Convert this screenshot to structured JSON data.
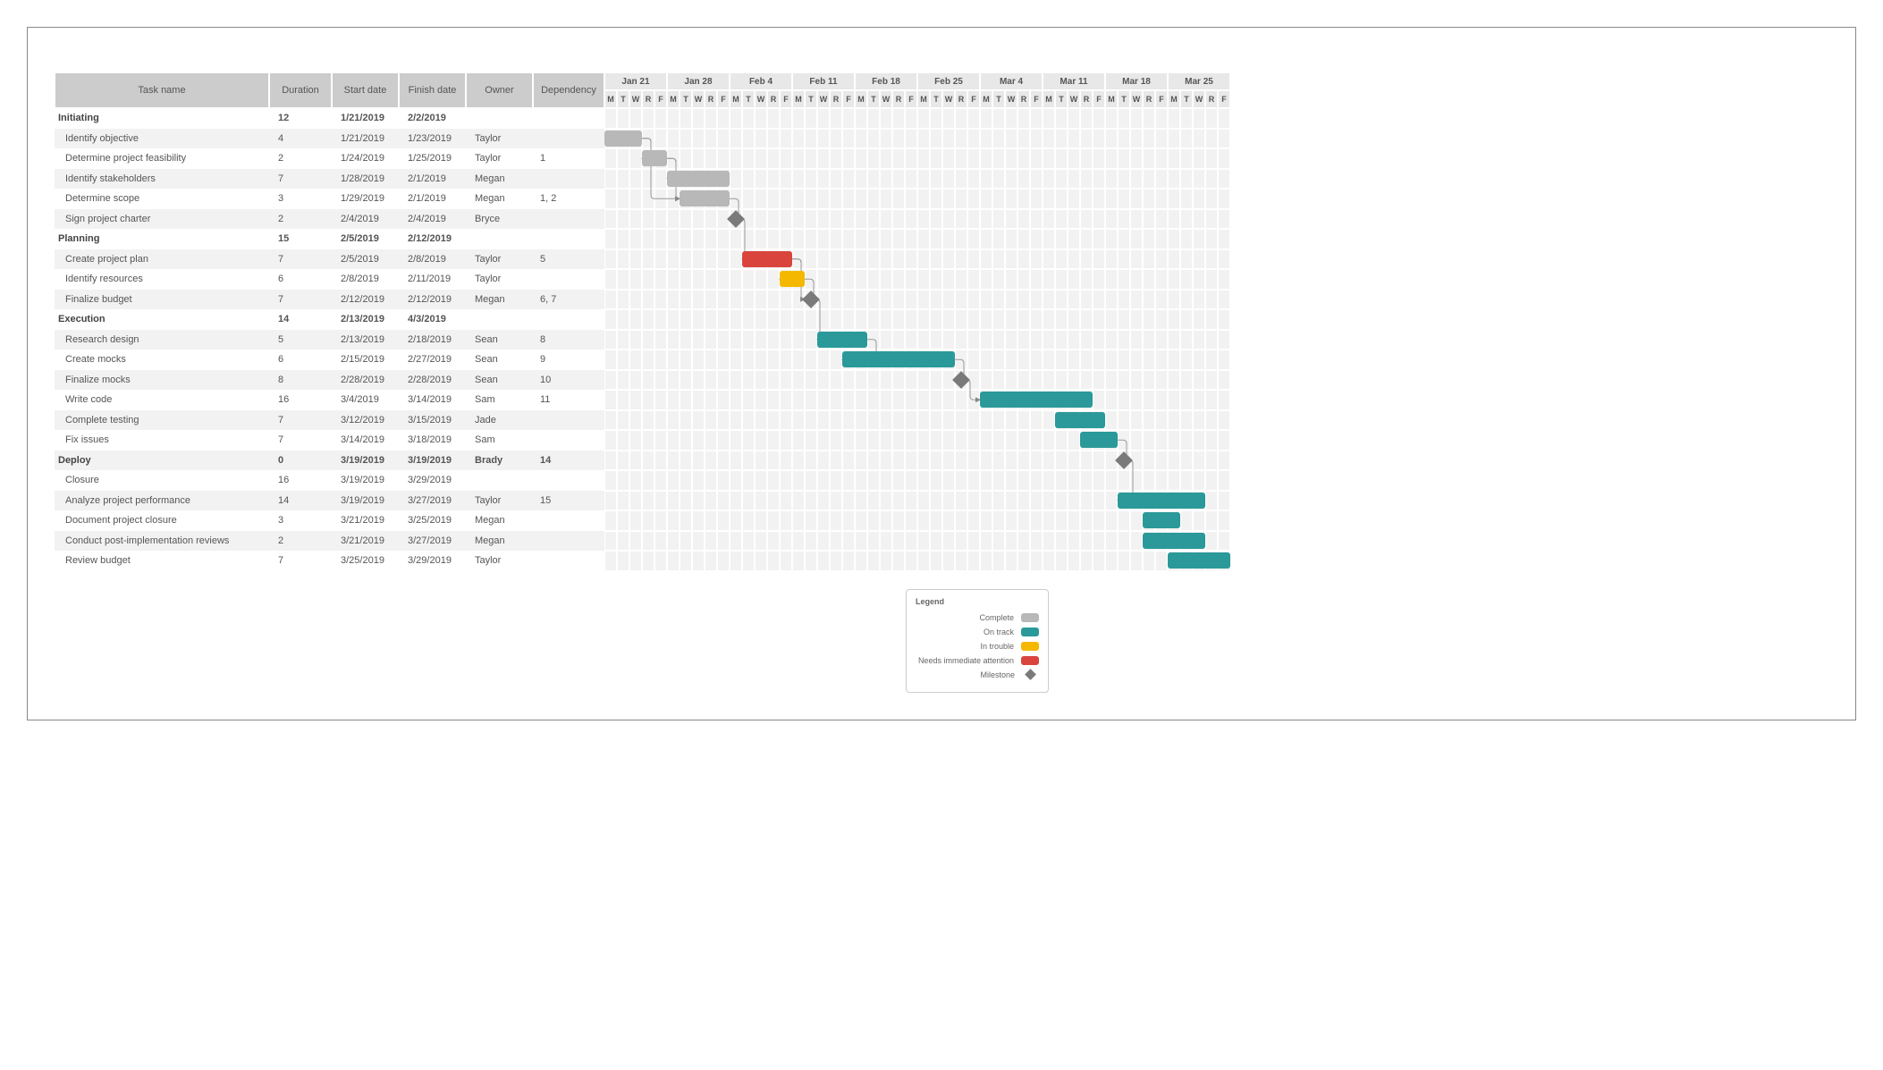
{
  "columns": {
    "task": "Task name",
    "duration": "Duration",
    "start": "Start date",
    "finish": "Finish date",
    "owner": "Owner",
    "dependency": "Dependency"
  },
  "weeks": [
    {
      "label": "Jan 21",
      "start": "2019-01-21"
    },
    {
      "label": "Jan 28",
      "start": "2019-01-28"
    },
    {
      "label": "Feb 4",
      "start": "2019-02-04"
    },
    {
      "label": "Feb 11",
      "start": "2019-02-11"
    },
    {
      "label": "Feb 18",
      "start": "2019-02-18"
    },
    {
      "label": "Feb 25",
      "start": "2019-02-25"
    },
    {
      "label": "Mar 4",
      "start": "2019-03-04"
    },
    {
      "label": "Mar 11",
      "start": "2019-03-11"
    },
    {
      "label": "Mar 18",
      "start": "2019-03-18"
    },
    {
      "label": "Mar 25",
      "start": "2019-03-25"
    }
  ],
  "dayLabels": [
    "M",
    "T",
    "W",
    "R",
    "F"
  ],
  "rows": [
    {
      "type": "group",
      "name": "Initiating",
      "duration": "12",
      "start": "1/21/2019",
      "finish": "2/2/2019",
      "owner": "",
      "dep": ""
    },
    {
      "type": "task",
      "name": "Identify objective",
      "duration": "4",
      "start": "1/21/2019",
      "finish": "1/23/2019",
      "owner": "Taylor",
      "dep": "",
      "barStart": "2019-01-21",
      "barEnd": "2019-01-23",
      "status": "complete"
    },
    {
      "type": "task",
      "name": "Determine project feasibility",
      "duration": "2",
      "start": "1/24/2019",
      "finish": "1/25/2019",
      "owner": "Taylor",
      "dep": "1",
      "barStart": "2019-01-24",
      "barEnd": "2019-01-25",
      "status": "complete"
    },
    {
      "type": "task",
      "name": "Identify stakeholders",
      "duration": "7",
      "start": "1/28/2019",
      "finish": "2/1/2019",
      "owner": "Megan",
      "dep": "",
      "barStart": "2019-01-28",
      "barEnd": "2019-02-01",
      "status": "complete"
    },
    {
      "type": "task",
      "name": "Determine scope",
      "duration": "3",
      "start": "1/29/2019",
      "finish": "2/1/2019",
      "owner": "Megan",
      "dep": "1, 2",
      "barStart": "2019-01-29",
      "barEnd": "2019-02-01",
      "status": "complete"
    },
    {
      "type": "task",
      "name": "Sign project charter",
      "duration": "2",
      "start": "2/4/2019",
      "finish": "2/4/2019",
      "owner": "Bryce",
      "dep": "",
      "milestone": "2019-02-04"
    },
    {
      "type": "group",
      "name": "Planning",
      "duration": "15",
      "start": "2/5/2019",
      "finish": "2/12/2019",
      "owner": "",
      "dep": ""
    },
    {
      "type": "task",
      "name": "Create project plan",
      "duration": "7",
      "start": "2/5/2019",
      "finish": "2/8/2019",
      "owner": "Taylor",
      "dep": "5",
      "barStart": "2019-02-05",
      "barEnd": "2019-02-08",
      "status": "needs"
    },
    {
      "type": "task",
      "name": "Identify resources",
      "duration": "6",
      "start": "2/8/2019",
      "finish": "2/11/2019",
      "owner": "Taylor",
      "dep": "",
      "barStart": "2019-02-08",
      "barEnd": "2019-02-11",
      "status": "trouble"
    },
    {
      "type": "task",
      "name": "Finalize budget",
      "duration": "7",
      "start": "2/12/2019",
      "finish": "2/12/2019",
      "owner": "Megan",
      "dep": "6, 7",
      "milestone": "2019-02-12"
    },
    {
      "type": "group",
      "name": "Execution",
      "duration": "14",
      "start": "2/13/2019",
      "finish": "4/3/2019",
      "owner": "",
      "dep": ""
    },
    {
      "type": "task",
      "name": "Research design",
      "duration": "5",
      "start": "2/13/2019",
      "finish": "2/18/2019",
      "owner": "Sean",
      "dep": "8",
      "barStart": "2019-02-13",
      "barEnd": "2019-02-18",
      "status": "ontrack"
    },
    {
      "type": "task",
      "name": "Create mocks",
      "duration": "6",
      "start": "2/15/2019",
      "finish": "2/27/2019",
      "owner": "Sean",
      "dep": "9",
      "barStart": "2019-02-15",
      "barEnd": "2019-02-27",
      "status": "ontrack"
    },
    {
      "type": "task",
      "name": "Finalize mocks",
      "duration": "8",
      "start": "2/28/2019",
      "finish": "2/28/2019",
      "owner": "Sean",
      "dep": "10",
      "milestone": "2019-02-28"
    },
    {
      "type": "task",
      "name": "Write code",
      "duration": "16",
      "start": "3/4/2019",
      "finish": "3/14/2019",
      "owner": "Sam",
      "dep": "11",
      "barStart": "2019-03-04",
      "barEnd": "2019-03-14",
      "status": "ontrack"
    },
    {
      "type": "task",
      "name": "Complete testing",
      "duration": "7",
      "start": "3/12/2019",
      "finish": "3/15/2019",
      "owner": "Jade",
      "dep": "",
      "barStart": "2019-03-12",
      "barEnd": "2019-03-15",
      "status": "ontrack"
    },
    {
      "type": "task",
      "name": "Fix issues",
      "duration": "7",
      "start": "3/14/2019",
      "finish": "3/18/2019",
      "owner": "Sam",
      "dep": "",
      "barStart": "2019-03-14",
      "barEnd": "2019-03-18",
      "status": "ontrack"
    },
    {
      "type": "group",
      "name": "Deploy",
      "duration": "0",
      "start": "3/19/2019",
      "finish": "3/19/2019",
      "owner": "Brady",
      "dep": "14",
      "milestone": "2019-03-19"
    },
    {
      "type": "task",
      "name": "Closure",
      "duration": "16",
      "start": "3/19/2019",
      "finish": "3/29/2019",
      "owner": "",
      "dep": ""
    },
    {
      "type": "task",
      "name": "Analyze project performance",
      "duration": "14",
      "start": "3/19/2019",
      "finish": "3/27/2019",
      "owner": "Taylor",
      "dep": "15",
      "barStart": "2019-03-19",
      "barEnd": "2019-03-27",
      "status": "ontrack"
    },
    {
      "type": "task",
      "name": "Document project closure",
      "duration": "3",
      "start": "3/21/2019",
      "finish": "3/25/2019",
      "owner": "Megan",
      "dep": "",
      "barStart": "2019-03-21",
      "barEnd": "2019-03-25",
      "status": "ontrack"
    },
    {
      "type": "task",
      "name": "Conduct post-implementation reviews",
      "duration": "2",
      "start": "3/21/2019",
      "finish": "3/27/2019",
      "owner": "Megan",
      "dep": "",
      "barStart": "2019-03-21",
      "barEnd": "2019-03-27",
      "status": "ontrack"
    },
    {
      "type": "task",
      "name": "Review budget",
      "duration": "7",
      "start": "3/25/2019",
      "finish": "3/29/2019",
      "owner": "Taylor",
      "dep": "",
      "barStart": "2019-03-25",
      "barEnd": "2019-03-29",
      "status": "ontrack"
    }
  ],
  "dependencies": [
    {
      "fromRow": 1,
      "toRow": 2
    },
    {
      "fromRow": 2,
      "toRow": 3
    },
    {
      "fromRow": 1,
      "toRow": 4
    },
    {
      "fromRow": 2,
      "toRow": 4
    },
    {
      "fromRow": 4,
      "toRow": 5
    },
    {
      "fromRow": 5,
      "toRow": 7
    },
    {
      "fromRow": 7,
      "toRow": 8
    },
    {
      "fromRow": 7,
      "toRow": 9
    },
    {
      "fromRow": 8,
      "toRow": 9
    },
    {
      "fromRow": 9,
      "toRow": 11
    },
    {
      "fromRow": 11,
      "toRow": 12
    },
    {
      "fromRow": 12,
      "toRow": 13
    },
    {
      "fromRow": 13,
      "toRow": 14
    },
    {
      "fromRow": 16,
      "toRow": 17
    },
    {
      "fromRow": 17,
      "toRow": 19
    }
  ],
  "legend": {
    "title": "Legend",
    "items": [
      {
        "label": "Complete",
        "class": "complete"
      },
      {
        "label": "On track",
        "class": "ontrack"
      },
      {
        "label": "In trouble",
        "class": "trouble"
      },
      {
        "label": "Needs immediate attention",
        "class": "needs"
      },
      {
        "label": "Milestone",
        "class": "milestone"
      }
    ]
  },
  "chart_data": {
    "type": "gantt",
    "timeline_start": "2019-01-21",
    "timeline_end": "2019-03-29",
    "workdays_per_week": 5,
    "bars": [
      {
        "task": "Identify objective",
        "start": "2019-01-21",
        "end": "2019-01-23",
        "status": "complete"
      },
      {
        "task": "Determine project feasibility",
        "start": "2019-01-24",
        "end": "2019-01-25",
        "status": "complete"
      },
      {
        "task": "Identify stakeholders",
        "start": "2019-01-28",
        "end": "2019-02-01",
        "status": "complete"
      },
      {
        "task": "Determine scope",
        "start": "2019-01-29",
        "end": "2019-02-01",
        "status": "complete"
      },
      {
        "task": "Sign project charter",
        "date": "2019-02-04",
        "milestone": true
      },
      {
        "task": "Create project plan",
        "start": "2019-02-05",
        "end": "2019-02-08",
        "status": "needs"
      },
      {
        "task": "Identify resources",
        "start": "2019-02-08",
        "end": "2019-02-11",
        "status": "trouble"
      },
      {
        "task": "Finalize budget",
        "date": "2019-02-12",
        "milestone": true
      },
      {
        "task": "Research design",
        "start": "2019-02-13",
        "end": "2019-02-18",
        "status": "ontrack"
      },
      {
        "task": "Create mocks",
        "start": "2019-02-15",
        "end": "2019-02-27",
        "status": "ontrack"
      },
      {
        "task": "Finalize mocks",
        "date": "2019-02-28",
        "milestone": true
      },
      {
        "task": "Write code",
        "start": "2019-03-04",
        "end": "2019-03-14",
        "status": "ontrack"
      },
      {
        "task": "Complete testing",
        "start": "2019-03-12",
        "end": "2019-03-15",
        "status": "ontrack"
      },
      {
        "task": "Fix issues",
        "start": "2019-03-14",
        "end": "2019-03-18",
        "status": "ontrack"
      },
      {
        "task": "Deploy",
        "date": "2019-03-19",
        "milestone": true
      },
      {
        "task": "Analyze project performance",
        "start": "2019-03-19",
        "end": "2019-03-27",
        "status": "ontrack"
      },
      {
        "task": "Document project closure",
        "start": "2019-03-21",
        "end": "2019-03-25",
        "status": "ontrack"
      },
      {
        "task": "Conduct post-implementation reviews",
        "start": "2019-03-21",
        "end": "2019-03-27",
        "status": "ontrack"
      },
      {
        "task": "Review budget",
        "start": "2019-03-25",
        "end": "2019-03-29",
        "status": "ontrack"
      }
    ]
  }
}
